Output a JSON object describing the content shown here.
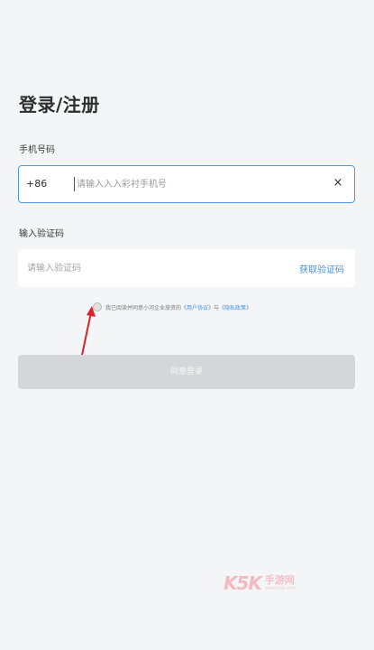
{
  "page": {
    "title": "登录/注册"
  },
  "phone": {
    "label": "手机号码",
    "country_code": "+86",
    "placeholder": "请输入入入彩衬手机号",
    "value": "",
    "clear_icon": "×"
  },
  "code": {
    "label": "输入验证码",
    "placeholder": "请输入验证码",
    "get_code_label": "获取验证码"
  },
  "agreement": {
    "text_prefix": "我已阅读并同意小河企业旅资的",
    "user_agreement": "《用户协议》",
    "conjunction": "与",
    "privacy_policy": "《隐私政策》"
  },
  "login_button": {
    "label": "同意登录"
  },
  "watermark": {
    "mark": "K5K",
    "name": "手游网",
    "url": "www.k5k.com"
  },
  "colors": {
    "accent": "#4c96e6",
    "link": "#4a90d9",
    "background": "#f4f5f7",
    "button_disabled": "#d4d6d9",
    "annotation_arrow": "#d8232a",
    "watermark": "#f2a7ae"
  }
}
